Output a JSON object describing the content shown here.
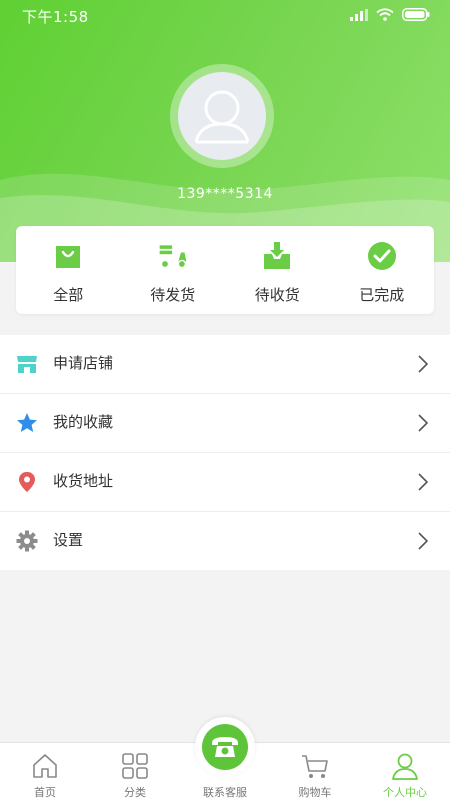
{
  "status_bar": {
    "time": "下午1:58"
  },
  "profile": {
    "phone": "139****5314"
  },
  "orders": [
    {
      "label": "全部",
      "icon": "shopping-bag-icon"
    },
    {
      "label": "待发货",
      "icon": "delivery-scooter-icon"
    },
    {
      "label": "待收货",
      "icon": "inbox-download-icon"
    },
    {
      "label": "已完成",
      "icon": "check-circle-icon"
    }
  ],
  "menu": [
    {
      "label": "申请店铺",
      "icon": "store-icon"
    },
    {
      "label": "我的收藏",
      "icon": "star-icon"
    },
    {
      "label": "收货地址",
      "icon": "location-pin-icon"
    },
    {
      "label": "设置",
      "icon": "gear-icon"
    }
  ],
  "tabs": [
    {
      "label": "首页",
      "icon": "home-icon"
    },
    {
      "label": "分类",
      "icon": "category-grid-icon"
    },
    {
      "label": "联系客服",
      "icon": "phone-icon"
    },
    {
      "label": "购物车",
      "icon": "cart-icon"
    },
    {
      "label": "个人中心",
      "icon": "user-icon",
      "active": true
    }
  ],
  "colors": {
    "brand_green": "#6acd45",
    "header_gradient_start": "#5fd033",
    "header_gradient_end": "#8ee06a",
    "store_icon": "#4fd3c8",
    "star_icon": "#2f8fe8",
    "location_icon": "#e35b5b",
    "gear_icon": "#8c8c8c"
  }
}
